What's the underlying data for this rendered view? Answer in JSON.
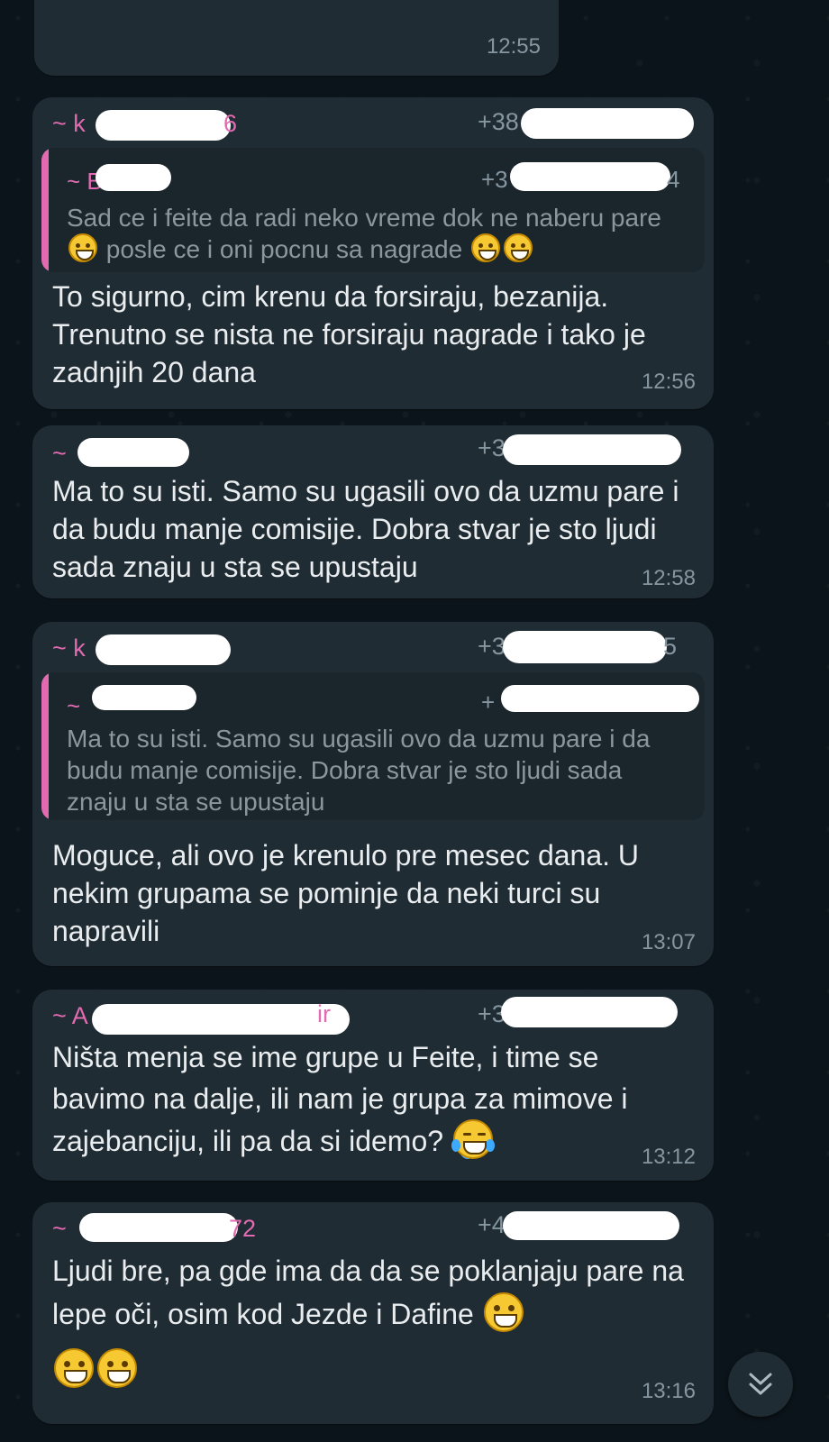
{
  "messages": [
    {
      "id": "m0",
      "sender": "",
      "phone": "",
      "text": "",
      "time": "12:55"
    },
    {
      "id": "m1",
      "sender": "~ k",
      "sender_tail": "6",
      "phone": "+38",
      "quote": {
        "sender": "~ B",
        "phone": "+3",
        "phone_tail": "4",
        "text_parts": [
          "Sad ce i feite da radi neko vreme dok ne naberu pare ",
          " posle ce i oni pocnu sa nagrade "
        ]
      },
      "text": "To sigurno, cim krenu da forsiraju, bezanija. Trenutno se nista ne forsiraju nagrade i tako je zadnjih 20 dana",
      "time": "12:56"
    },
    {
      "id": "m2",
      "sender": "~",
      "phone": "+3",
      "text": "Ma to su isti. Samo su ugasili ovo da uzmu pare i da budu manje comisije. Dobra stvar je sto ljudi sada znaju u sta se upustaju",
      "time": "12:58"
    },
    {
      "id": "m3",
      "sender": "~ k",
      "phone": "+3",
      "phone_tail": "5",
      "quote": {
        "sender": "~",
        "phone": "+",
        "text": "Ma to su isti. Samo su ugasili ovo da uzmu pare i da budu manje comisije. Dobra stvar je sto ljudi sada znaju u sta se upustaju"
      },
      "text": "Moguce, ali ovo je krenulo pre mesec dana. U nekim grupama se pominje da neki turci su napravili",
      "time": "13:07"
    },
    {
      "id": "m4",
      "sender": "~ A",
      "sender_tail": "ir",
      "phone": "+3",
      "text": "Ništa menja se ime grupe u Feite, i time se bavimo na dalje, ili nam je grupa za mimove i zajebanciju, ili pa da si idemo? ",
      "time": "13:12"
    },
    {
      "id": "m5",
      "sender": "~",
      "sender_tail": "72",
      "phone": "+4",
      "text": "Ljudi bre, pa gde ima da da se poklanjaju pare na lepe oči, osim kod Jezde i Dafine ",
      "time": "13:16"
    }
  ],
  "icons": {
    "grin_emoji": "grinning-face-emoji",
    "laugh_emoji": "tears-of-joy-emoji",
    "scroll_down": "double-chevron-down-icon"
  },
  "colors": {
    "background": "#0b141a",
    "bubble": "#202c33",
    "sender_name": "#e26ab1",
    "timestamp": "#8696a0",
    "message_text": "#e9edef"
  }
}
